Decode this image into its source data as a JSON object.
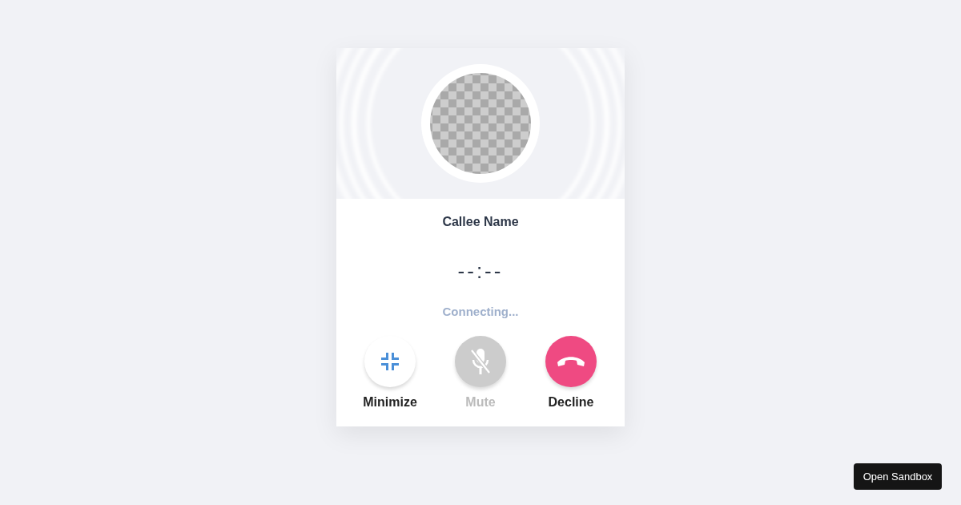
{
  "call": {
    "callee_name": "Callee Name",
    "timer": "--:--",
    "status": "Connecting..."
  },
  "actions": [
    {
      "kind": "minimize",
      "label": "Minimize",
      "disabled": false
    },
    {
      "kind": "mute",
      "label": "Mute",
      "disabled": true
    },
    {
      "kind": "decline",
      "label": "Decline",
      "disabled": false
    }
  ],
  "sandbox_button": {
    "label": "Open Sandbox"
  }
}
